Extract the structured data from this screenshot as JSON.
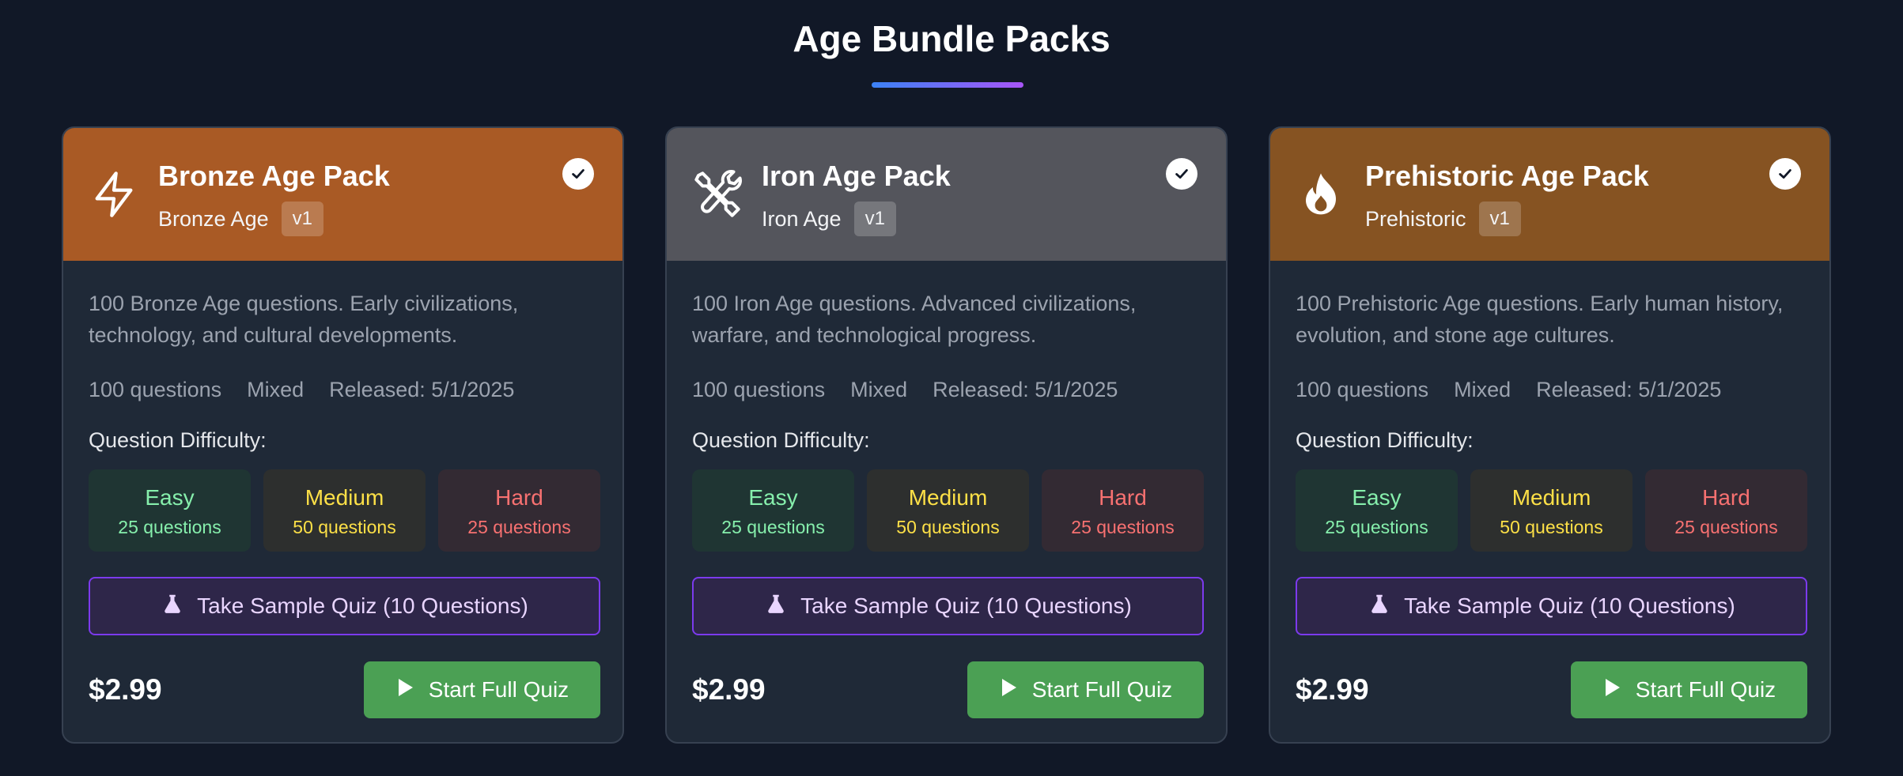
{
  "page": {
    "title": "Age Bundle Packs"
  },
  "cards": [
    {
      "name": "Bronze Age Pack",
      "age": "Bronze Age",
      "version": "v1",
      "header_color": "#a95a25",
      "icon": "lightning-icon",
      "description": "100 Bronze Age questions. Early civilizations, technology, and cultural developments.",
      "meta": {
        "questions": "100 questions",
        "difficulty": "Mixed",
        "released": "Released: 5/1/2025"
      },
      "difficulty_label": "Question Difficulty:",
      "easy": {
        "label": "Easy",
        "count": "25 questions"
      },
      "medium": {
        "label": "Medium",
        "count": "50 questions"
      },
      "hard": {
        "label": "Hard",
        "count": "25 questions"
      },
      "sample_label": "Take Sample Quiz (10 Questions)",
      "price": "$2.99",
      "start_label": "Start Full Quiz"
    },
    {
      "name": "Iron Age Pack",
      "age": "Iron Age",
      "version": "v1",
      "header_color": "#54555c",
      "icon": "tools-icon",
      "description": "100 Iron Age questions. Advanced civilizations, warfare, and technological progress.",
      "meta": {
        "questions": "100 questions",
        "difficulty": "Mixed",
        "released": "Released: 5/1/2025"
      },
      "difficulty_label": "Question Difficulty:",
      "easy": {
        "label": "Easy",
        "count": "25 questions"
      },
      "medium": {
        "label": "Medium",
        "count": "50 questions"
      },
      "hard": {
        "label": "Hard",
        "count": "25 questions"
      },
      "sample_label": "Take Sample Quiz (10 Questions)",
      "price": "$2.99",
      "start_label": "Start Full Quiz"
    },
    {
      "name": "Prehistoric Age Pack",
      "age": "Prehistoric",
      "version": "v1",
      "header_color": "#865322",
      "icon": "flame-icon",
      "description": "100 Prehistoric Age questions. Early human history, evolution, and stone age cultures.",
      "meta": {
        "questions": "100 questions",
        "difficulty": "Mixed",
        "released": "Released: 5/1/2025"
      },
      "difficulty_label": "Question Difficulty:",
      "easy": {
        "label": "Easy",
        "count": "25 questions"
      },
      "medium": {
        "label": "Medium",
        "count": "50 questions"
      },
      "hard": {
        "label": "Hard",
        "count": "25 questions"
      },
      "sample_label": "Take Sample Quiz (10 Questions)",
      "price": "$2.99",
      "start_label": "Start Full Quiz"
    }
  ]
}
